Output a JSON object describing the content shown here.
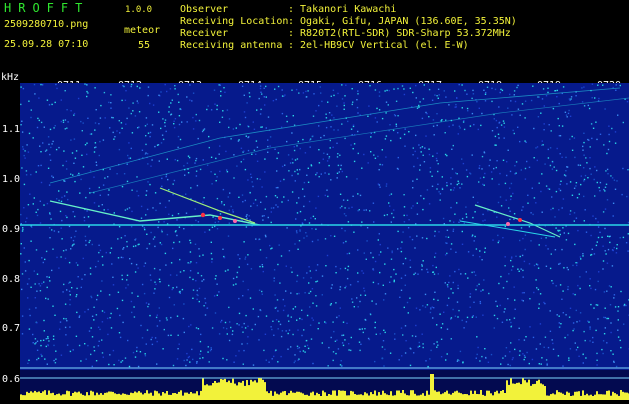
{
  "header": {
    "logo": "HROFFT",
    "version": "1.0.0",
    "filename": "2509280710.png",
    "datetime": "25.09.28 07:10",
    "meteor_label": "meteor",
    "meteor_count": "55"
  },
  "info": [
    {
      "label": "Observer",
      "value": ": Takanori Kawachi"
    },
    {
      "label": "Receiving Location",
      "value": ": Ogaki, Gifu, JAPAN (136.60E, 35.35N)"
    },
    {
      "label": "Receiver",
      "value": ": R820T2(RTL-SDR) SDR-Sharp 53.372MHz"
    },
    {
      "label": "Receiving antenna",
      "value": ": 2el-HB9CV Vertical (el. E-W)"
    }
  ],
  "axis": {
    "unit": "kHz",
    "time_labels": [
      "0711",
      "0712",
      "0713",
      "0714",
      "0715",
      "0716",
      "0717",
      "0718",
      "0719",
      "0720"
    ],
    "freq_labels": [
      "1.1",
      "1.0",
      "0.9",
      "0.8",
      "0.7",
      "0.6"
    ]
  },
  "colors": {
    "background": "#000000",
    "spectrogram_base": "#061a8c",
    "noise_cyan": "#2ad6e8",
    "signal_red": "#ff3344",
    "histogram_yellow": "#f2f23a",
    "text_green": "#2fe62f",
    "text_yellow": "#f2f23a"
  }
}
